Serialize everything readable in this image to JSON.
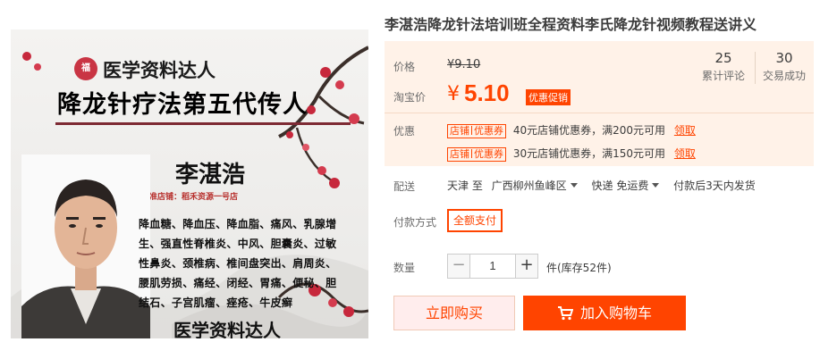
{
  "product": {
    "title": "李湛浩降龙针法培训班全程资料李氏降龙针视频教程送讲义"
  },
  "poster": {
    "brand_top": "医学资料达人",
    "stamp_char": "福",
    "headline": "降龙针疗法第五代传人",
    "teacher": "李湛浩",
    "store_line": "认准店铺：稻禾资源一号店",
    "diseases": "降血糖、降血压、降血脂、痛风、乳腺增生、强直性脊椎炎、中风、胆囊炎、过敏性鼻炎、颈椎病、椎间盘突出、肩周炎、腰肌劳损、痛经、闭经、胃痛、便秘、胆结石、子宫肌瘤、痤疮、牛皮癣",
    "brand_bottom": "医学资料达人"
  },
  "pricing": {
    "price_label": "价格",
    "original_price": "¥9.10",
    "taobao_label": "淘宝价",
    "currency": "¥",
    "sale_price": "5.10",
    "promo_tag": "优惠促销"
  },
  "stats": {
    "reviews_count": "25",
    "reviews_label": "累计评论",
    "deals_count": "30",
    "deals_label": "交易成功"
  },
  "coupons": {
    "label": "优惠",
    "items": [
      {
        "tag_a": "店铺",
        "tag_b": "优惠券",
        "text": "40元店铺优惠券，满200元可用",
        "claim": "领取"
      },
      {
        "tag_a": "店铺",
        "tag_b": "优惠券",
        "text": "30元店铺优惠券，满150元可用",
        "claim": "领取"
      }
    ]
  },
  "shipping": {
    "label": "配送",
    "from": "天津 至",
    "to": "广西柳州鱼峰区",
    "method": "快递 免运费",
    "dispatch": "付款后3天内发货"
  },
  "payment": {
    "label": "付款方式",
    "option": "全额支付"
  },
  "quantity": {
    "label": "数量",
    "minus": "−",
    "value": "1",
    "plus": "+",
    "stock": "件(库存52件)"
  },
  "actions": {
    "buy_now": "立即购买",
    "add_cart": "加入购物车"
  },
  "colors": {
    "accent": "#ff4400",
    "panel_bg": "#fff2e8",
    "buy_now_bg": "#ffeded"
  }
}
